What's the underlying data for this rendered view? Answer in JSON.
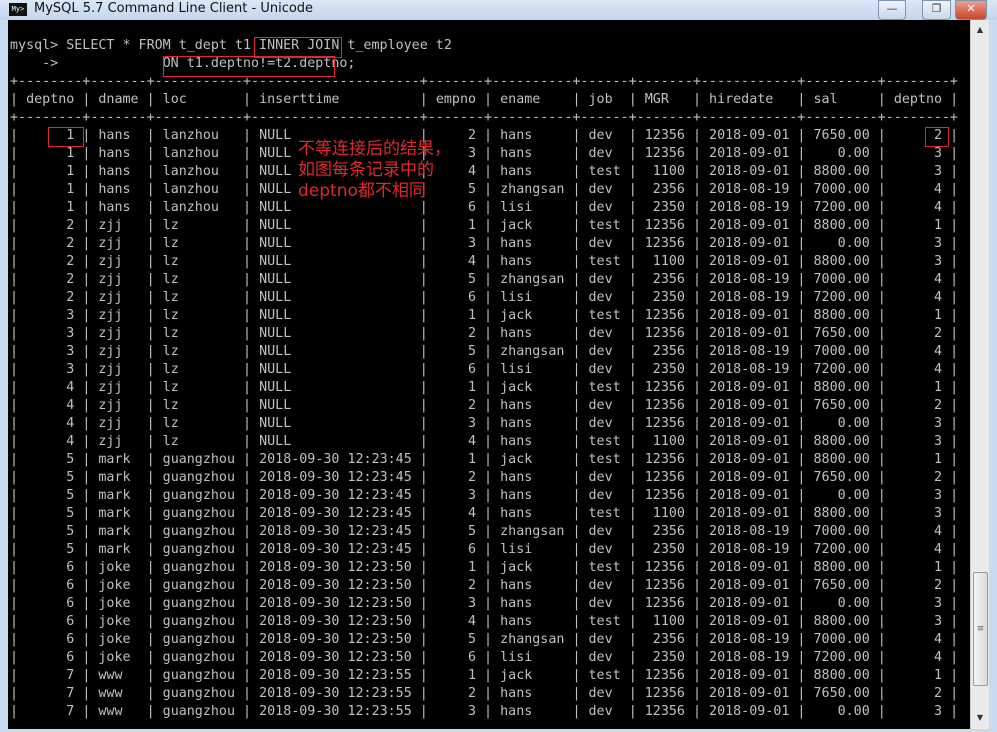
{
  "window": {
    "title": "MySQL 5.7 Command Line Client - Unicode",
    "icon": "mysql-console-icon",
    "icon_text": "My>",
    "minimize": "—",
    "restore": "❐",
    "close": "✕"
  },
  "terminal": {
    "command_line1": "mysql> SELECT * FROM t_dept t1 INNER JOIN t_employee t2",
    "command_line2": "    ->             ON t1.deptno!=t2.deptno;",
    "text_color": "#c0c0c0",
    "highlight_color": "#e0282c"
  },
  "annotation": {
    "lines": [
      "不等连接后的结果，",
      "如图每条记录中的",
      "deptno都不相同"
    ]
  },
  "table": {
    "columns": [
      "deptno",
      "dname",
      "loc",
      "inserttime",
      "empno",
      "ename",
      "job",
      "MGR",
      "hiredate",
      "sal",
      "deptno"
    ],
    "rows": [
      [
        "1",
        "hans",
        "lanzhou",
        "NULL",
        "2",
        "hans",
        "dev",
        "12356",
        "2018-09-01",
        "7650.00",
        "2"
      ],
      [
        "1",
        "hans",
        "lanzhou",
        "NULL",
        "3",
        "hans",
        "dev",
        "12356",
        "2018-09-01",
        "0.00",
        "3"
      ],
      [
        "1",
        "hans",
        "lanzhou",
        "NULL",
        "4",
        "hans",
        "test",
        "1100",
        "2018-09-01",
        "8800.00",
        "3"
      ],
      [
        "1",
        "hans",
        "lanzhou",
        "NULL",
        "5",
        "zhangsan",
        "dev",
        "2356",
        "2018-08-19",
        "7000.00",
        "4"
      ],
      [
        "1",
        "hans",
        "lanzhou",
        "NULL",
        "6",
        "lisi",
        "dev",
        "2350",
        "2018-08-19",
        "7200.00",
        "4"
      ],
      [
        "2",
        "zjj",
        "lz",
        "NULL",
        "1",
        "jack",
        "test",
        "12356",
        "2018-09-01",
        "8800.00",
        "1"
      ],
      [
        "2",
        "zjj",
        "lz",
        "NULL",
        "3",
        "hans",
        "dev",
        "12356",
        "2018-09-01",
        "0.00",
        "3"
      ],
      [
        "2",
        "zjj",
        "lz",
        "NULL",
        "4",
        "hans",
        "test",
        "1100",
        "2018-09-01",
        "8800.00",
        "3"
      ],
      [
        "2",
        "zjj",
        "lz",
        "NULL",
        "5",
        "zhangsan",
        "dev",
        "2356",
        "2018-08-19",
        "7000.00",
        "4"
      ],
      [
        "2",
        "zjj",
        "lz",
        "NULL",
        "6",
        "lisi",
        "dev",
        "2350",
        "2018-08-19",
        "7200.00",
        "4"
      ],
      [
        "3",
        "zjj",
        "lz",
        "NULL",
        "1",
        "jack",
        "test",
        "12356",
        "2018-09-01",
        "8800.00",
        "1"
      ],
      [
        "3",
        "zjj",
        "lz",
        "NULL",
        "2",
        "hans",
        "dev",
        "12356",
        "2018-09-01",
        "7650.00",
        "2"
      ],
      [
        "3",
        "zjj",
        "lz",
        "NULL",
        "5",
        "zhangsan",
        "dev",
        "2356",
        "2018-08-19",
        "7000.00",
        "4"
      ],
      [
        "3",
        "zjj",
        "lz",
        "NULL",
        "6",
        "lisi",
        "dev",
        "2350",
        "2018-08-19",
        "7200.00",
        "4"
      ],
      [
        "4",
        "zjj",
        "lz",
        "NULL",
        "1",
        "jack",
        "test",
        "12356",
        "2018-09-01",
        "8800.00",
        "1"
      ],
      [
        "4",
        "zjj",
        "lz",
        "NULL",
        "2",
        "hans",
        "dev",
        "12356",
        "2018-09-01",
        "7650.00",
        "2"
      ],
      [
        "4",
        "zjj",
        "lz",
        "NULL",
        "3",
        "hans",
        "dev",
        "12356",
        "2018-09-01",
        "0.00",
        "3"
      ],
      [
        "4",
        "zjj",
        "lz",
        "NULL",
        "4",
        "hans",
        "test",
        "1100",
        "2018-09-01",
        "8800.00",
        "3"
      ],
      [
        "5",
        "mark",
        "guangzhou",
        "2018-09-30 12:23:45",
        "1",
        "jack",
        "test",
        "12356",
        "2018-09-01",
        "8800.00",
        "1"
      ],
      [
        "5",
        "mark",
        "guangzhou",
        "2018-09-30 12:23:45",
        "2",
        "hans",
        "dev",
        "12356",
        "2018-09-01",
        "7650.00",
        "2"
      ],
      [
        "5",
        "mark",
        "guangzhou",
        "2018-09-30 12:23:45",
        "3",
        "hans",
        "dev",
        "12356",
        "2018-09-01",
        "0.00",
        "3"
      ],
      [
        "5",
        "mark",
        "guangzhou",
        "2018-09-30 12:23:45",
        "4",
        "hans",
        "test",
        "1100",
        "2018-09-01",
        "8800.00",
        "3"
      ],
      [
        "5",
        "mark",
        "guangzhou",
        "2018-09-30 12:23:45",
        "5",
        "zhangsan",
        "dev",
        "2356",
        "2018-08-19",
        "7000.00",
        "4"
      ],
      [
        "5",
        "mark",
        "guangzhou",
        "2018-09-30 12:23:45",
        "6",
        "lisi",
        "dev",
        "2350",
        "2018-08-19",
        "7200.00",
        "4"
      ],
      [
        "6",
        "joke",
        "guangzhou",
        "2018-09-30 12:23:50",
        "1",
        "jack",
        "test",
        "12356",
        "2018-09-01",
        "8800.00",
        "1"
      ],
      [
        "6",
        "joke",
        "guangzhou",
        "2018-09-30 12:23:50",
        "2",
        "hans",
        "dev",
        "12356",
        "2018-09-01",
        "7650.00",
        "2"
      ],
      [
        "6",
        "joke",
        "guangzhou",
        "2018-09-30 12:23:50",
        "3",
        "hans",
        "dev",
        "12356",
        "2018-09-01",
        "0.00",
        "3"
      ],
      [
        "6",
        "joke",
        "guangzhou",
        "2018-09-30 12:23:50",
        "4",
        "hans",
        "test",
        "1100",
        "2018-09-01",
        "8800.00",
        "3"
      ],
      [
        "6",
        "joke",
        "guangzhou",
        "2018-09-30 12:23:50",
        "5",
        "zhangsan",
        "dev",
        "2356",
        "2018-08-19",
        "7000.00",
        "4"
      ],
      [
        "6",
        "joke",
        "guangzhou",
        "2018-09-30 12:23:50",
        "6",
        "lisi",
        "dev",
        "2350",
        "2018-08-19",
        "7200.00",
        "4"
      ],
      [
        "7",
        "www",
        "guangzhou",
        "2018-09-30 12:23:55",
        "1",
        "jack",
        "test",
        "12356",
        "2018-09-01",
        "8800.00",
        "1"
      ],
      [
        "7",
        "www",
        "guangzhou",
        "2018-09-30 12:23:55",
        "2",
        "hans",
        "dev",
        "12356",
        "2018-09-01",
        "7650.00",
        "2"
      ],
      [
        "7",
        "www",
        "guangzhou",
        "2018-09-30 12:23:55",
        "3",
        "hans",
        "dev",
        "12356",
        "2018-09-01",
        "0.00",
        "3"
      ]
    ]
  },
  "scrollbar": {
    "up": "▲",
    "down": "▼",
    "grip": "≡"
  }
}
